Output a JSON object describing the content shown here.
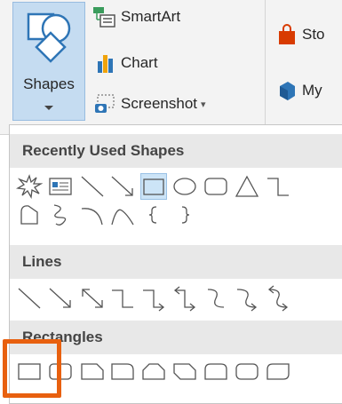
{
  "ribbon": {
    "shapes_label": "Shapes",
    "smartart_label": "SmartArt",
    "chart_label": "Chart",
    "screenshot_label": "Screenshot",
    "store_label": "Sto",
    "myaddins_label": "My",
    "icons": {
      "shapes": "shapes-icon",
      "smartart": "smartart-icon",
      "chart": "bar-chart-icon",
      "screenshot": "screenshot-icon",
      "store": "store-bag-icon",
      "myaddins": "addins-icon"
    }
  },
  "gallery": {
    "sections": [
      {
        "title": "Recently Used Shapes",
        "rows": [
          [
            "explosion-icon",
            "text-box-icon",
            "line-icon",
            "arrow-line-icon",
            "rectangle-icon",
            "oval-icon",
            "rounded-rectangle-icon",
            "triangle-icon",
            "elbow-connector-icon"
          ],
          [
            "freeform-icon",
            "scribble-icon",
            "arc-icon",
            "curve-icon",
            "left-brace-icon",
            "right-brace-icon"
          ]
        ],
        "highlighted": "rectangle-icon"
      },
      {
        "title": "Lines",
        "rows": [
          [
            "line-icon",
            "arrow-line-icon",
            "double-arrow-line-icon",
            "elbow-connector-icon",
            "elbow-arrow-connector-icon",
            "elbow-double-arrow-connector-icon",
            "curved-connector-icon",
            "curved-arrow-connector-icon",
            "curved-double-arrow-connector-icon"
          ]
        ]
      },
      {
        "title": "Rectangles",
        "rows": [
          [
            "rectangle-icon",
            "rounded-rectangle-icon",
            "snip-single-corner-rectangle-icon",
            "round-single-corner-rectangle-icon",
            "snip-same-side-corner-rectangle-icon",
            "snip-diagonal-corner-rectangle-icon",
            "round-same-side-corner-rectangle-icon",
            "rounded-rectangle-icon",
            "round-diagonal-corner-rectangle-icon"
          ]
        ]
      }
    ]
  },
  "colors": {
    "highlight": "#cce4f7",
    "callout": "#e8600f",
    "chart_blue": "#2e75b6",
    "chart_gold": "#f0a30a",
    "store_red": "#d83b01"
  }
}
